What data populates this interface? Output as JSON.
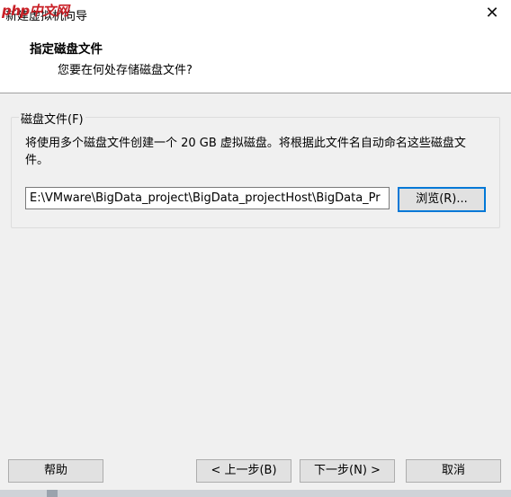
{
  "window": {
    "title": "新建虚拟机向导",
    "watermark": "php中文网",
    "close_glyph": "✕"
  },
  "header": {
    "title": "指定磁盘文件",
    "subtitle": "您要在何处存储磁盘文件?"
  },
  "disk_group": {
    "legend": "磁盘文件(F)",
    "description": "将使用多个磁盘文件创建一个 20 GB 虚拟磁盘。将根据此文件名自动命名这些磁盘文件。",
    "path_value": "E:\\VMware\\BigData_project\\BigData_projectHost\\BigData_Pr",
    "browse_label": "浏览(R)..."
  },
  "footer": {
    "help_label": "帮助",
    "prev_label": "< 上一步(B)",
    "next_label": "下一步(N) >",
    "cancel_label": "取消"
  },
  "colors": {
    "accent": "#0078d7",
    "watermark": "#c92027"
  }
}
